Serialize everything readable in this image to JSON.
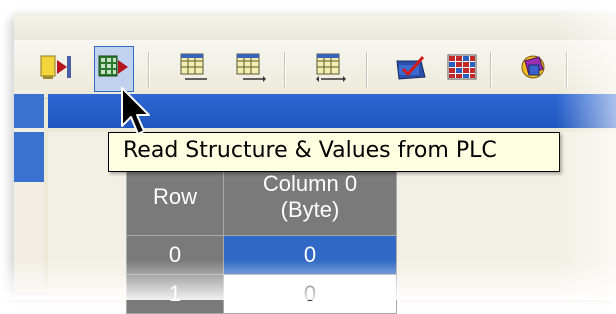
{
  "toolbar": {
    "buttons": [
      {
        "icon": "insert-structure-icon"
      },
      {
        "icon": "read-structure-values-icon",
        "active": true
      },
      {
        "icon": "grid-edit-icon"
      },
      {
        "icon": "grid-edit-arrow-icon"
      },
      {
        "icon": "grid-move-icon"
      },
      {
        "icon": "chart-check-icon"
      },
      {
        "icon": "color-grid-icon"
      },
      {
        "icon": "shapes-icon"
      }
    ]
  },
  "tooltip": {
    "text": "Read Structure & Values from PLC"
  },
  "grid": {
    "row_header": "Row",
    "column_header_line1": "Column 0",
    "column_header_line2": "(Byte)",
    "rows": [
      {
        "row": "0",
        "value": "0"
      },
      {
        "row": "1",
        "value": "0"
      }
    ]
  },
  "colors": {
    "selection": "#3169c6",
    "header_gray": "#7a7a7a",
    "tooltip_bg": "#ffffe1"
  }
}
